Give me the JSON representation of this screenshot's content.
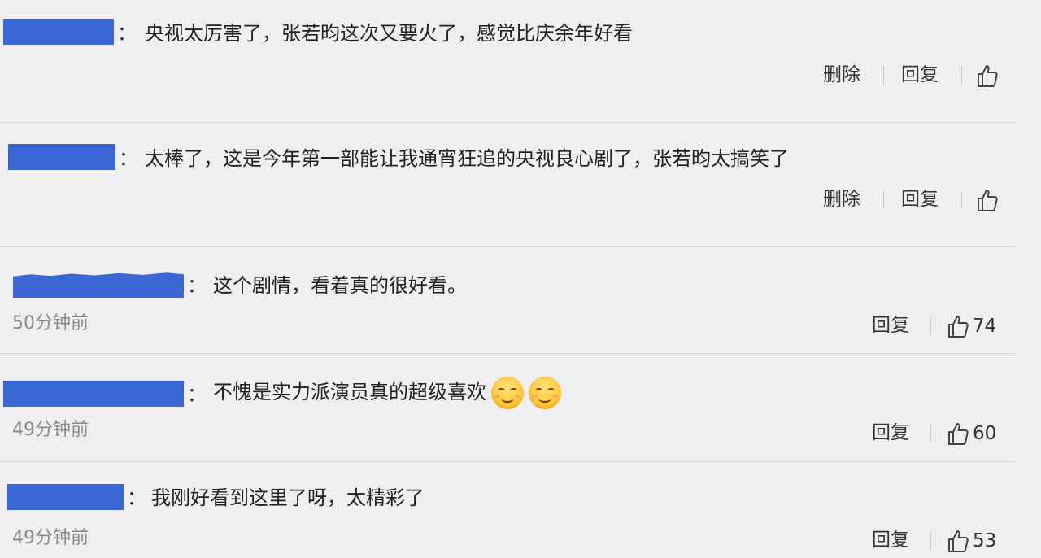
{
  "colors": {
    "background": "#efeff1",
    "username_redaction": "#3a66d6",
    "separator": "#d8d8dc",
    "timestamp": "#8a8a8a"
  },
  "separator_char": "：",
  "comments": [
    {
      "text": "央视太厉害了，张若昀这次又要火了，感觉比庆余年好看",
      "actions": {
        "delete": "删除",
        "reply": "回复"
      },
      "like_icon": "thumbs-up-icon"
    },
    {
      "text": "太棒了，这是今年第一部能让我通宵狂追的央视良心剧了，张若昀太搞笑了",
      "actions": {
        "delete": "删除",
        "reply": "回复"
      },
      "like_icon": "thumbs-up-icon"
    },
    {
      "text": "这个剧情，看着真的很好看。",
      "timestamp": "50分钟前",
      "actions": {
        "reply": "回复"
      },
      "like_icon": "thumbs-up-icon",
      "likes": "74"
    },
    {
      "text": "不愧是实力派演员真的超级喜欢",
      "emojis": [
        "smiling-face-emoji",
        "smiling-face-emoji"
      ],
      "timestamp": "49分钟前",
      "actions": {
        "reply": "回复"
      },
      "like_icon": "thumbs-up-icon",
      "likes": "60"
    },
    {
      "text": "我刚好看到这里了呀，太精彩了",
      "timestamp": "49分钟前",
      "actions": {
        "reply": "回复"
      },
      "like_icon": "thumbs-up-icon",
      "likes": "53"
    }
  ]
}
